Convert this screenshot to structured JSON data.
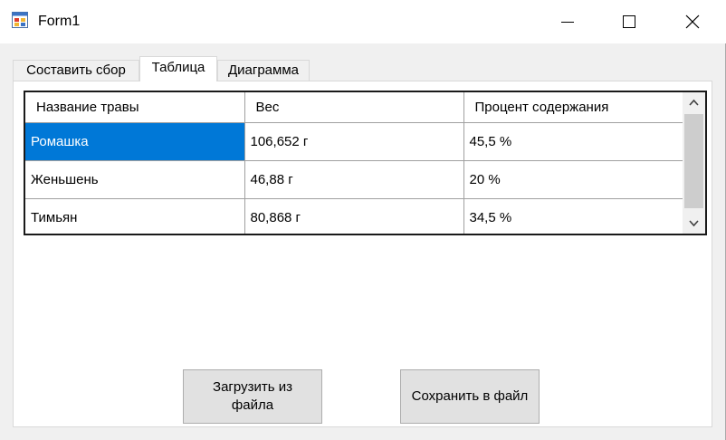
{
  "window": {
    "title": "Form1"
  },
  "tabs": [
    {
      "label": "Составить сбор"
    },
    {
      "label": "Таблица"
    },
    {
      "label": "Диаграмма"
    }
  ],
  "grid": {
    "headers": [
      "Название травы",
      "Вес",
      "Процент содержания"
    ],
    "rows": [
      [
        "Ромашка",
        "106,652 г",
        "45,5 %"
      ],
      [
        "Женьшень",
        "46,88 г",
        "20 %"
      ],
      [
        "Тимьян",
        "80,868 г",
        "34,5 %"
      ]
    ],
    "selected_row": 0
  },
  "buttons": {
    "load": "Загрузить из файла",
    "save": "Сохранить в файл"
  },
  "colors": {
    "selection": "#0078d7",
    "title_bar": "#ffffff",
    "button_face": "#e1e1e1"
  }
}
